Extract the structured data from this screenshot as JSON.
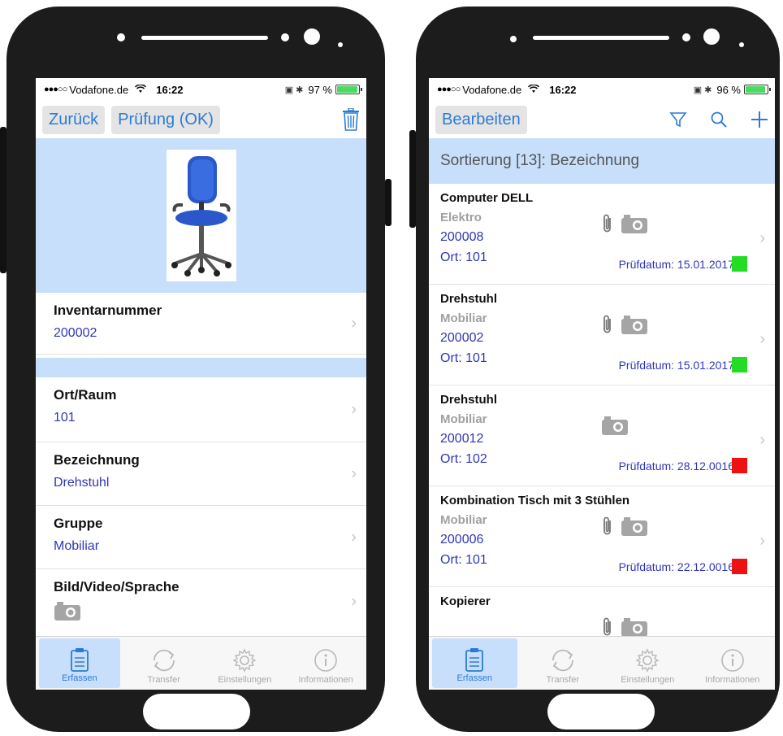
{
  "colors": {
    "accent": "#2b7bd6",
    "highlight": "#c7dffb",
    "value_text": "#2f36b8",
    "status_green": "#22dd22",
    "status_red": "#ee1111"
  },
  "left": {
    "status": {
      "carrier": "Vodafone.de",
      "time": "16:22",
      "battery": "97 %"
    },
    "nav": {
      "back": "Zurück",
      "check": "Prüfung (OK)",
      "trash_icon": "trash-icon"
    },
    "hero_image": "office-chair",
    "rows": [
      {
        "label": "Inventarnummer",
        "value": "200002"
      },
      {
        "label": "Ort/Raum",
        "value": "101"
      },
      {
        "label": "Bezeichnung",
        "value": "Drehstuhl"
      },
      {
        "label": "Gruppe",
        "value": "Mobiliar"
      },
      {
        "label": "Bild/Video/Sprache",
        "value": ""
      }
    ]
  },
  "right": {
    "status": {
      "carrier": "Vodafone.de",
      "time": "16:22",
      "battery": "96 %"
    },
    "nav": {
      "edit": "Bearbeiten"
    },
    "sort_label": "Sortierung [13]: Bezeichnung",
    "items": [
      {
        "title": "Computer DELL",
        "group": "Elektro",
        "number": "200008",
        "ort": "Ort: 101",
        "date": "Prüfdatum: 15.01.2017",
        "status": "green",
        "clip": true
      },
      {
        "title": "Drehstuhl",
        "group": "Mobiliar",
        "number": "200002",
        "ort": "Ort: 101",
        "date": "Prüfdatum: 15.01.2017",
        "status": "green",
        "clip": true
      },
      {
        "title": "Drehstuhl",
        "group": "Mobiliar",
        "number": "200012",
        "ort": "Ort: 102",
        "date": "Prüfdatum: 28.12.0016",
        "status": "red",
        "clip": false
      },
      {
        "title": "Kombination Tisch mit 3 Stühlen",
        "group": "Mobiliar",
        "number": "200006",
        "ort": "Ort: 101",
        "date": "Prüfdatum: 22.12.0016",
        "status": "red",
        "clip": true
      },
      {
        "title": "Kopierer",
        "group": "",
        "number": "",
        "ort": "",
        "date": "",
        "status": "",
        "clip": true
      }
    ]
  },
  "tabs": [
    {
      "label": "Erfassen",
      "icon": "clipboard-icon",
      "active": true
    },
    {
      "label": "Transfer",
      "icon": "sync-icon",
      "active": false
    },
    {
      "label": "Einstellungen",
      "icon": "gear-icon",
      "active": false
    },
    {
      "label": "Informationen",
      "icon": "info-icon",
      "active": false
    }
  ]
}
